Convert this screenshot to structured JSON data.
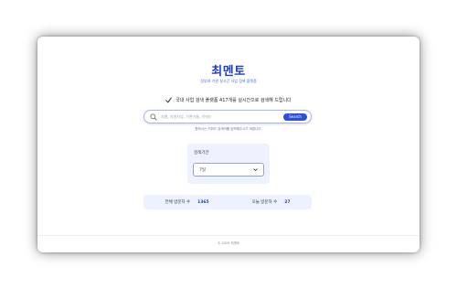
{
  "header": {
    "logo": "최멘토",
    "tagline": "정부와 기관 실시간 사업 검색 플랫폼"
  },
  "notice": {
    "icon": "check-icon",
    "text": "국내 사업 검색 플랫폼 417개를 실시간으로 검색해 드립니다"
  },
  "search": {
    "icon": "search-icon",
    "placeholder": "지원, 지원사업, 기관이름, 키워드",
    "button_label": "Search",
    "hint": "원하시는 키워드 검색어를 입력해주시기 바랍니다."
  },
  "period": {
    "label": "검색기간",
    "selected": "7일",
    "icon": "chevron-down-icon"
  },
  "stats": {
    "total_label": "전체 방문자 수",
    "total_value": "1365",
    "today_label": "오늘 방문자 수",
    "today_value": "27"
  },
  "footer": {
    "text": "© 2025 최멘토"
  },
  "colors": {
    "accent": "#2f4fd3",
    "logo": "#1f3fbf",
    "panel_bg": "#eef2ff"
  }
}
